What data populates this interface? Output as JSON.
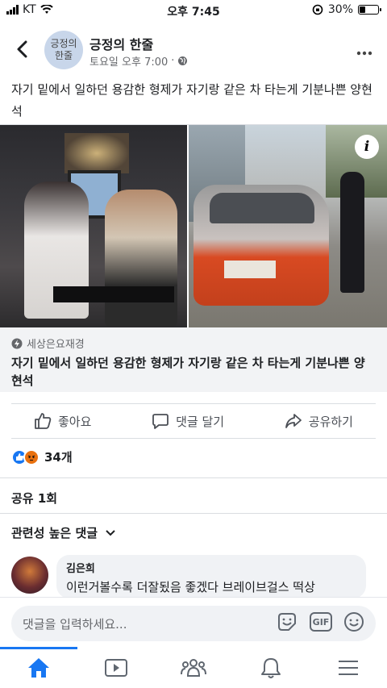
{
  "status_bar": {
    "carrier": "KT",
    "time": "오후 7:45",
    "battery": "30%",
    "battery_level": 0.3
  },
  "post": {
    "page_avatar_text": [
      "긍정의",
      "한줄"
    ],
    "page_name": "긍정의 한줄",
    "timestamp": "토요일 오후 7:00",
    "separator": "·",
    "caption": "자기 밑에서 일하던 용감한 형제가 자기랑 같은 차 타는게 기분나쁜 양현석"
  },
  "link_card": {
    "source": "세상은요재경",
    "title": "자기 밑에서 일하던 용감한 형제가 자기랑 같은 차 타는게 기분나쁜 양현석",
    "info_label": "i"
  },
  "actions": {
    "like": "좋아요",
    "comment": "댓글 달기",
    "share": "공유하기"
  },
  "reactions": {
    "count": "34개",
    "types": [
      "like",
      "angry"
    ]
  },
  "shares": "공유 1회",
  "comments": {
    "sort_label": "관련성 높은 댓글",
    "items": [
      {
        "name": "김은희",
        "text": "이런거볼수록 더잘됬음 좋겠다 브레이브걸스 떡상"
      }
    ]
  },
  "comment_input": {
    "placeholder": "댓글을 입력하세요...",
    "gif_label": "GIF"
  },
  "colors": {
    "accent": "#1877f2",
    "angry": "#e9710f",
    "card_bg": "#f2f3f5"
  }
}
